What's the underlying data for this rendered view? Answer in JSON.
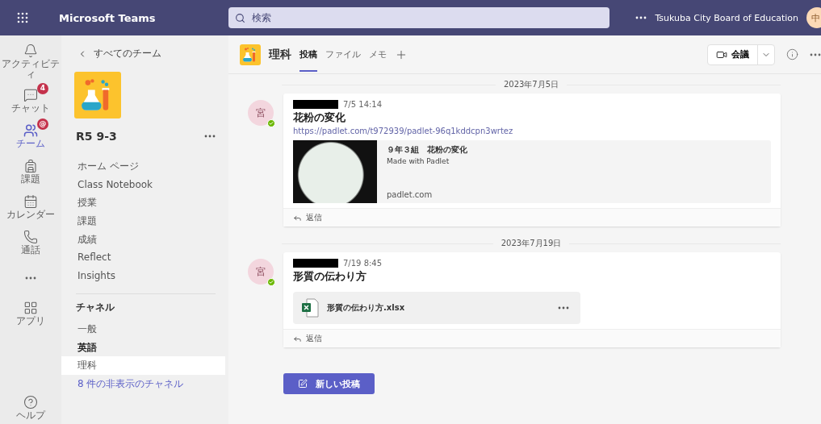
{
  "app_bar": {
    "title": "Microsoft Teams",
    "search_placeholder": "検索",
    "organization": "Tsukuba City Board of Education",
    "avatar_initial": "中"
  },
  "rail": [
    {
      "kind": "bell",
      "label": "アクティビティ",
      "selected": false
    },
    {
      "kind": "chat",
      "label": "チャット",
      "selected": false,
      "badge": "4"
    },
    {
      "kind": "teams",
      "label": "チーム",
      "selected": true,
      "badge": "@"
    },
    {
      "kind": "backpack",
      "label": "課題",
      "selected": false
    },
    {
      "kind": "calendar",
      "label": "カレンダー",
      "selected": false
    },
    {
      "kind": "phone",
      "label": "通話",
      "selected": false
    },
    {
      "kind": "more",
      "selected": false
    },
    {
      "kind": "apps",
      "label": "アプリ",
      "selected": false
    }
  ],
  "rail_footer": {
    "label": "ヘルプ"
  },
  "sidebar": {
    "back_link": "すべてのチーム",
    "team_name": "R5 9-3",
    "nav": [
      "ホーム ページ",
      "Class Notebook",
      "授業",
      "課題",
      "成績",
      "Reflect",
      "Insights"
    ],
    "channels_heading": "チャネル",
    "channels": [
      {
        "name": "一般",
        "selected": false,
        "unread": false
      },
      {
        "name": "英語",
        "selected": false,
        "unread": true
      },
      {
        "name": "理科",
        "selected": true,
        "unread": false
      }
    ],
    "hidden_channels": "8 件の非表示のチャネル"
  },
  "channel_header": {
    "name": "理科",
    "tabs": [
      {
        "label": "投稿",
        "selected": true
      },
      {
        "label": "ファイル",
        "selected": false
      },
      {
        "label": "メモ",
        "selected": false
      }
    ],
    "meet_button": "会議"
  },
  "feed": [
    {
      "date": "2023年7月5日",
      "avatar": "宮",
      "time": "7/5 14:14",
      "title": "花粉の変化",
      "link": "https://padlet.com/t972939/padlet-96q1kddcpn3wrtez",
      "attachment": {
        "kind": "link",
        "title": "９年３組　花粉の変化",
        "subtitle": "Made with Padlet",
        "domain": "padlet.com"
      },
      "reply": "返信"
    },
    {
      "date": "2023年7月19日",
      "avatar": "宮",
      "time": "7/19 8:45",
      "title": "形質の伝わり方",
      "attachment": {
        "kind": "file",
        "title": "形質の伝わり方.xlsx"
      },
      "reply": "返信"
    }
  ],
  "new_post_button": "新しい投稿"
}
